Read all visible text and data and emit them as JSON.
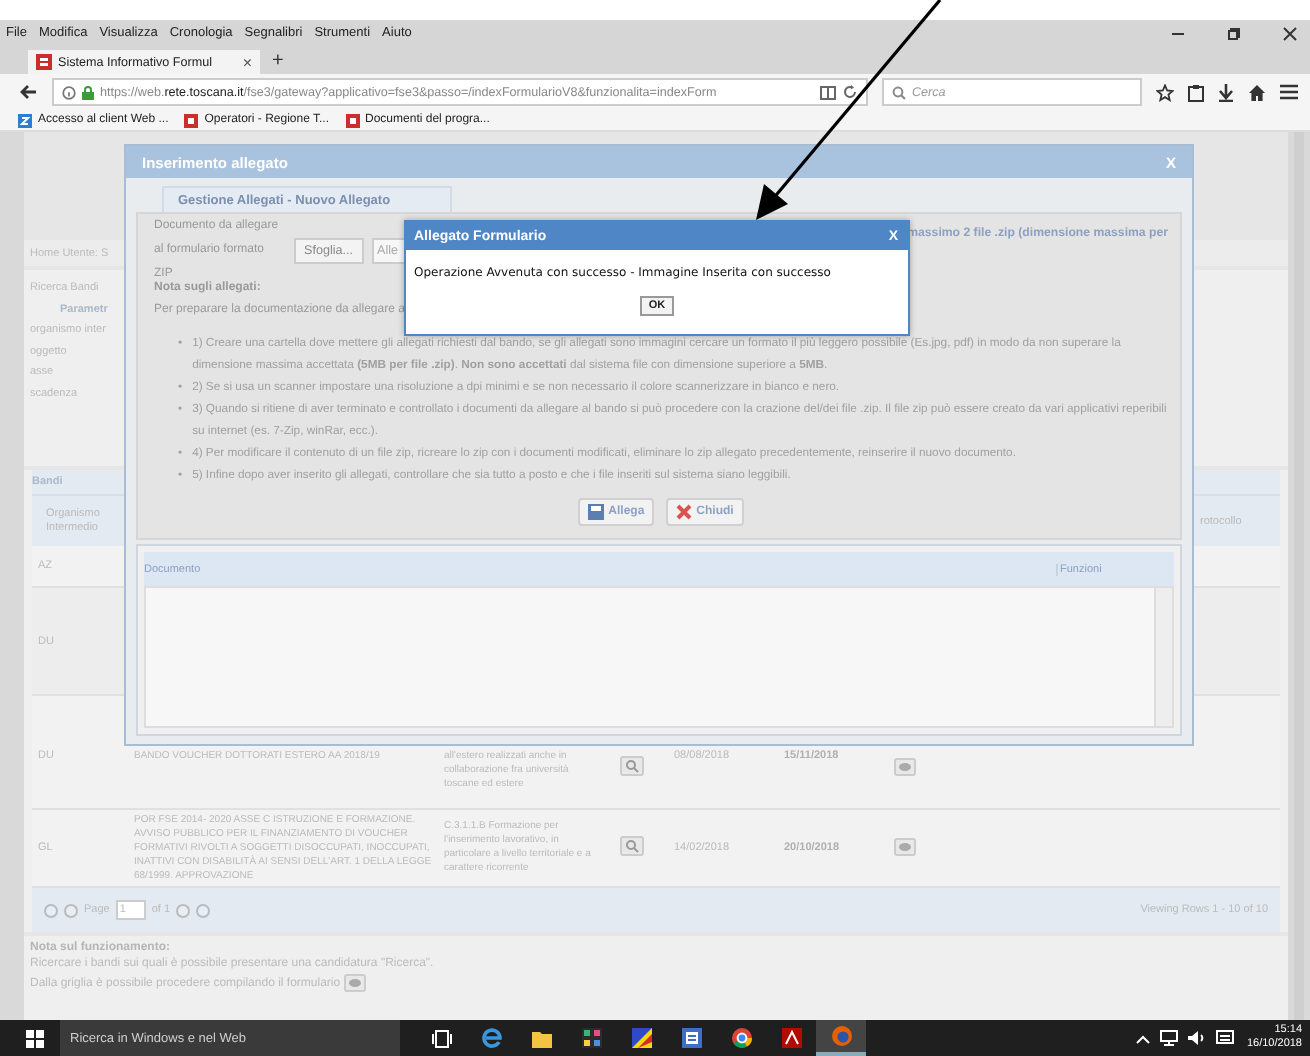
{
  "browser": {
    "menu": [
      "File",
      "Modifica",
      "Visualizza",
      "Cronologia",
      "Segnalibri",
      "Strumenti",
      "Aiuto"
    ],
    "tab": {
      "title": "Sistema Informativo Formul",
      "close": "×"
    },
    "new_tab": "+",
    "url": {
      "prefix": "https://web.",
      "domain": "rete.toscana.it",
      "path": "/fse3/gateway?applicativo=fse3&passo=/indexFormularioV8&funzionalita=indexForm"
    },
    "search": {
      "placeholder": "Cerca"
    },
    "bookmarks": [
      {
        "label": "Accesso al client Web ...",
        "kind": "z"
      },
      {
        "label": "Operatori - Regione T...",
        "kind": "red"
      },
      {
        "label": "Documenti del progra...",
        "kind": "red"
      }
    ]
  },
  "page": {
    "user_label": "Home Utente: S",
    "tab": "Ricerca Bandi",
    "section": "Parametr",
    "filters": [
      "organismo inter",
      "oggetto",
      "asse",
      "scadenza"
    ],
    "grid": {
      "title": "Bandi",
      "columns": [
        "Organismo Intermedio",
        "rotocollo"
      ],
      "rows": [
        {
          "code": "AZ"
        },
        {
          "code": "DU"
        },
        {
          "code": "DU",
          "title": "BANDO VOUCHER DOTTORATI ESTERO AA 2018/19",
          "description": "all'estero realizzati anche in collaborazione fra università toscane ed estere",
          "date_1": "08/08/2018",
          "date_2": "15/11/2018"
        },
        {
          "code": "GL",
          "title": "POR FSE 2014- 2020 ASSE C ISTRUZIONE E FORMAZIONE. AVVISO PUBBLICO PER IL FINANZIAMENTO DI VOUCHER FORMATIVI RIVOLTI A SOGGETTI DISOCCUPATI, INOCCUPATI, INATTIVI CON DISABILITÀ AI SENSI DELL'ART. 1 DELLA LEGGE 68/1999. APPROVAZIONE",
          "description": "C.3.1.1.B Formazione per l'inserimento lavorativo, in particolare a livello territoriale e a carattere ricorrente",
          "date_1": "14/02/2018",
          "date_2": "20/10/2018"
        }
      ],
      "pager": {
        "page_label": "Page",
        "page": "1",
        "of": "of 1",
        "viewing": "Viewing Rows 1 - 10 of 10"
      }
    },
    "note": {
      "title": "Nota sul funzionamento:",
      "lines": [
        "Ricercare i bandi sui quali è possibile presentare una candidatura \"Ricerca\".",
        "Dalla griglia è possibile procedere compilando il formulario"
      ]
    }
  },
  "modal": {
    "title": "Inserimento allegato",
    "close": "X",
    "tab": "Gestione Allegati - Nuovo Allegato",
    "upload_label": [
      "Documento da allegare",
      "al formulario formato ZIP"
    ],
    "browse": "Sfoglia...",
    "file_value": "Alle",
    "limit_text": "massimo 2 file .zip (dimensione massima per",
    "note_title": "Nota sugli allegati:",
    "note_intro": "Per preparare la documentazione da allegare a",
    "bullet_marker": "•",
    "bullets": [
      "1) Creare una cartella dove mettere gli allegati richiesti dal bando, se gli allegati sono immagini cercare un formato il più leggero possibile (Es.jpg, pdf) in modo da non superare la dimensione massima accettata **(5MB per file .zip)**. **Non sono accettati** dal sistema file con dimensione superiore a **5MB**.",
      "2) Se si usa un scanner impostare una risoluzione a dpi minimi e se non necessario il colore scannerizzare in bianco e nero.",
      "3) Quando si ritiene di aver terminato e controllato i documenti da allegare al bando si può procedere con la crazione del/dei file .zip. Il file zip può essere creato da vari applicativi reperibili su internet (es. 7-Zip, winRar, ecc.).",
      "4) Per modificare il contenuto di un file zip, ricreare lo zip con i documenti modificati, eliminare lo zip allegato precedentemente, reinserire il nuovo documento.",
      "5) Infine dopo aver inserito gli allegati, controllare che sia tutto a posto e che i file inseriti sul sistema siano leggibili."
    ],
    "buttons": [
      {
        "label": "Allega",
        "kind": "save"
      },
      {
        "label": "Chiudi",
        "kind": "close"
      }
    ],
    "table_columns": [
      "Documento",
      "Funzioni"
    ]
  },
  "dialog": {
    "title": "Allegato Formulario",
    "close": "X",
    "message": "Operazione Avvenuta con successo - Immagine Inserita con successo",
    "ok": "OK"
  },
  "taskbar": {
    "search": "Ricerca in Windows e nel Web",
    "apps": [
      {
        "kind": "taskview",
        "selected": false
      },
      {
        "kind": "edge",
        "selected": false
      },
      {
        "kind": "folder",
        "selected": false
      },
      {
        "kind": "grid",
        "selected": false
      },
      {
        "kind": "paint",
        "selected": false
      },
      {
        "kind": "doc",
        "selected": false
      },
      {
        "kind": "chrome",
        "selected": false
      },
      {
        "kind": "pdf",
        "selected": false
      },
      {
        "kind": "firefox",
        "selected": true
      }
    ],
    "time": "15:14",
    "date": "16/10/2018"
  }
}
